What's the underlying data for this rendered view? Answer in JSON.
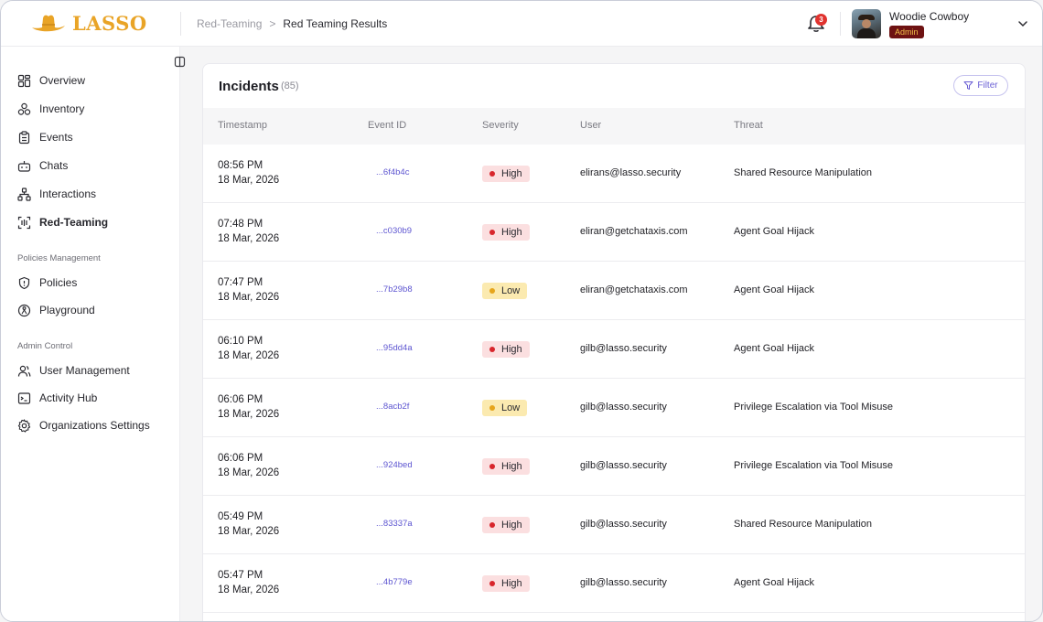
{
  "app": {
    "logo_text": "LASSO",
    "brand_color": "#E9A427"
  },
  "breadcrumb": {
    "parent": "Red-Teaming",
    "separator": ">",
    "current": "Red Teaming Results"
  },
  "notifications": {
    "count": "3",
    "icon": "bell-icon"
  },
  "user": {
    "name": "Woodie Cowboy",
    "role": "Admin"
  },
  "sidebar": {
    "items": [
      {
        "label": "Overview",
        "icon": "grid-icon"
      },
      {
        "label": "Inventory",
        "icon": "cubes-icon"
      },
      {
        "label": "Events",
        "icon": "clipboard-icon"
      },
      {
        "label": "Chats",
        "icon": "bot-icon"
      },
      {
        "label": "Interactions",
        "icon": "network-icon"
      },
      {
        "label": "Red-Teaming",
        "icon": "scan-icon",
        "active": true
      }
    ],
    "sections": [
      {
        "title": "Policies Management",
        "items": [
          {
            "label": "Policies",
            "icon": "shield-icon"
          },
          {
            "label": "Playground",
            "icon": "playground-icon"
          }
        ]
      },
      {
        "title": "Admin Control",
        "items": [
          {
            "label": "User Management",
            "icon": "users-icon"
          },
          {
            "label": "Activity Hub",
            "icon": "terminal-icon"
          },
          {
            "label": "Organizations Settings",
            "icon": "gear-icon"
          }
        ]
      }
    ]
  },
  "incidents": {
    "title": "Incidents",
    "count": "(85)",
    "filter_label": "Filter",
    "columns": [
      "Timestamp",
      "Event ID",
      "Severity",
      "User",
      "Threat"
    ],
    "rows": [
      {
        "time": "08:56 PM",
        "date": "18 Mar, 2026",
        "event_id": "...6f4b4c",
        "severity": "High",
        "user": "elirans@lasso.security",
        "threat": "Shared Resource Manipulation"
      },
      {
        "time": "07:48 PM",
        "date": "18 Mar, 2026",
        "event_id": "...c030b9",
        "severity": "High",
        "user": "eliran@getchataxis.com",
        "threat": "Agent Goal Hijack"
      },
      {
        "time": "07:47 PM",
        "date": "18 Mar, 2026",
        "event_id": "...7b29b8",
        "severity": "Low",
        "user": "eliran@getchataxis.com",
        "threat": "Agent Goal Hijack"
      },
      {
        "time": "06:10 PM",
        "date": "18 Mar, 2026",
        "event_id": "...95dd4a",
        "severity": "High",
        "user": "gilb@lasso.security",
        "threat": "Agent Goal Hijack"
      },
      {
        "time": "06:06 PM",
        "date": "18 Mar, 2026",
        "event_id": "...8acb2f",
        "severity": "Low",
        "user": "gilb@lasso.security",
        "threat": "Privilege Escalation via Tool Misuse"
      },
      {
        "time": "06:06 PM",
        "date": "18 Mar, 2026",
        "event_id": "...924bed",
        "severity": "High",
        "user": "gilb@lasso.security",
        "threat": "Privilege Escalation via Tool Misuse"
      },
      {
        "time": "05:49 PM",
        "date": "18 Mar, 2026",
        "event_id": "...83337a",
        "severity": "High",
        "user": "gilb@lasso.security",
        "threat": "Shared Resource Manipulation"
      },
      {
        "time": "05:47 PM",
        "date": "18 Mar, 2026",
        "event_id": "...4b779e",
        "severity": "High",
        "user": "gilb@lasso.security",
        "threat": "Agent Goal Hijack"
      }
    ]
  },
  "colors": {
    "severity_high_bg": "#FBDFE0",
    "severity_high_dot": "#D8262C",
    "severity_low_bg": "#FBEAB0",
    "severity_low_dot": "#E6A51C",
    "event_id_link": "#5E56D1",
    "role_badge_bg": "#6E1212",
    "role_badge_text": "#F2C04A"
  }
}
